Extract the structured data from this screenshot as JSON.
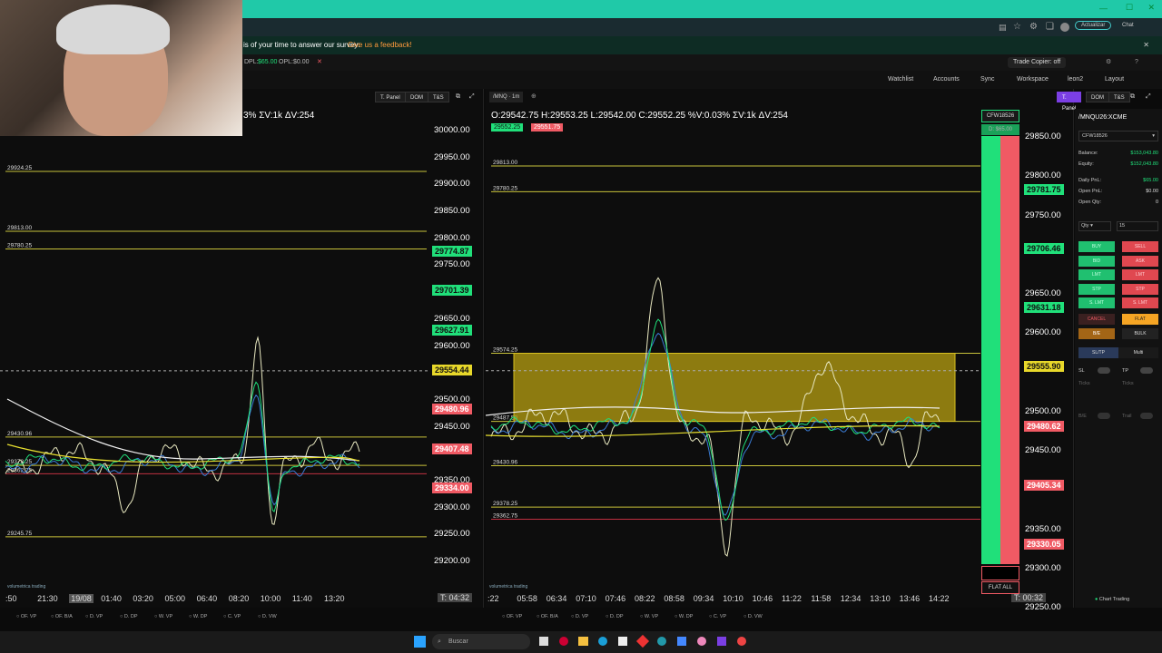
{
  "survey": {
    "text": "is of your time to answer our survey:",
    "link": "Give us a feedback!"
  },
  "account_bar": {
    "dpl_label": "DPL:",
    "dpl_value": "$65.00",
    "opl_label": "OPL:",
    "opl_value": "$0.00",
    "trade_copier": "Trade Copier: off"
  },
  "toolbar": {
    "watchlist": "Watchlist",
    "accounts": "Accounts",
    "sync": "Sync",
    "workspace": "Workspace",
    "user": "leon2",
    "layout": "Layout"
  },
  "browser": {
    "update": "Actualizar",
    "chat": "Chat"
  },
  "left_chart": {
    "header_buttons": [
      "T. Panel",
      "DOM",
      "T&S"
    ],
    "ohlc": "3% ΣV:1k ΔV:254",
    "axis_prices": [
      "30000.00",
      "29950.00",
      "29900.00",
      "29850.00",
      "29800.00",
      "29750.00",
      "29650.00",
      "29600.00",
      "29500.00",
      "29450.00",
      "29350.00",
      "29300.00",
      "29250.00",
      "29200.00"
    ],
    "level_labels": [
      "29924.25",
      "29813.00",
      "29780.25",
      "29430.96",
      "29378.25",
      "29362.75",
      "29245.75"
    ],
    "tags": [
      {
        "value": "29774.87",
        "color": "green"
      },
      {
        "value": "29701.39",
        "color": "green"
      },
      {
        "value": "29627.91",
        "color": "green"
      },
      {
        "value": "29554.44",
        "color": "yellow"
      },
      {
        "value": "29480.96",
        "color": "red"
      },
      {
        "value": "29407.48",
        "color": "red"
      },
      {
        "value": "29334.00",
        "color": "red"
      }
    ],
    "time_labels": [
      ":50",
      "21:30",
      "19/08",
      "01:40",
      "03:20",
      "05:00",
      "06:40",
      "08:20",
      "10:00",
      "11:40",
      "13:20"
    ],
    "timer": "T: 04:32",
    "bottom_tabs": [
      "OF. VP",
      "OF. B/A",
      "D. VP",
      "D. DP",
      "W. VP",
      "W. DP",
      "C. VP",
      "D. VW"
    ],
    "brand": "volumetrica trading"
  },
  "right_chart": {
    "symbol": "/MNQ",
    "interval": "1m",
    "header_buttons": [
      "T. Panel",
      "DOM",
      "T&S"
    ],
    "ohlc": "O:29542.75  H:29553.25  L:29542.00  C:29552.25  %V:0.03%  ΣV:1k  ΔV:254",
    "bid_tag": "29552.25",
    "ask_tag": "29551.75",
    "axis_prices": [
      "29850.00",
      "29800.00",
      "29750.00",
      "29650.00",
      "29600.00",
      "29500.00",
      "29450.00",
      "29350.00",
      "29300.00",
      "29250.00"
    ],
    "level_labels": [
      "29813.00",
      "29780.25",
      "29574.25",
      "29487.50",
      "29430.96",
      "29378.25",
      "29362.75",
      "29245.75"
    ],
    "tags": [
      {
        "value": "29781.75",
        "color": "green"
      },
      {
        "value": "29706.46",
        "color": "green"
      },
      {
        "value": "29631.18",
        "color": "green"
      },
      {
        "value": "29555.90",
        "color": "yellow"
      },
      {
        "value": "29480.62",
        "color": "red"
      },
      {
        "value": "29405.34",
        "color": "red"
      },
      {
        "value": "29330.05",
        "color": "red"
      }
    ],
    "time_labels": [
      ":22",
      "05:58",
      "06:34",
      "07:10",
      "07:46",
      "08:22",
      "08:58",
      "09:34",
      "10:10",
      "10:46",
      "11:22",
      "11:58",
      "12:34",
      "13:10",
      "13:46",
      "14:22"
    ],
    "timer": "T: 00:32",
    "bottom_tabs": [
      "OF. VP",
      "OF. B/A",
      "D. VP",
      "D. DP",
      "W. VP",
      "W. DP",
      "C. VP",
      "D. VW"
    ],
    "brand": "volumetrica trading",
    "account_tag": "CFW18526",
    "pnl_tag": "D: $65.00",
    "flat_all": "FLAT ALL"
  },
  "trade_panel": {
    "instrument": "/MNQU26:XCME",
    "account": "CFW18526",
    "rows": [
      {
        "label": "Balance:",
        "value": "$153,043.80",
        "color": "#20e07a"
      },
      {
        "label": "Equity:",
        "value": "$152,043.80",
        "color": "#20e07a"
      },
      {
        "label": "Daily PnL:",
        "value": "$65.00",
        "color": "#20e07a"
      },
      {
        "label": "Open PnL:",
        "value": "$0.00",
        "color": "#dddddd"
      },
      {
        "label": "Open Qty:",
        "value": "0",
        "color": "#dddddd"
      }
    ],
    "qty_label": "Qty",
    "qty_value": "15",
    "buttons": [
      {
        "left": "BUY",
        "right": "SELL"
      },
      {
        "left": "BID",
        "right": "ASK"
      },
      {
        "left": "LMT",
        "right": "LMT"
      },
      {
        "left": "STP",
        "right": "STP"
      },
      {
        "left": "S. LMT",
        "right": "S. LMT"
      }
    ],
    "cancel": "CANCEL",
    "flat": "FLAT",
    "be": "B/E",
    "bulk": "BULK",
    "sltp": "SL/TP",
    "multi": "Multi",
    "sl": "SL",
    "tp": "TP",
    "ticks": "Ticks",
    "bracket": "B/E",
    "trail": "Trail",
    "footer": "Chart Trading"
  },
  "taskbar": {
    "search": "Buscar"
  },
  "colors": {
    "accent": "#20c9a8",
    "green": "#20e07a",
    "red": "#f05a64",
    "yellow": "#e8d82a",
    "purple": "#7b3fe4"
  }
}
